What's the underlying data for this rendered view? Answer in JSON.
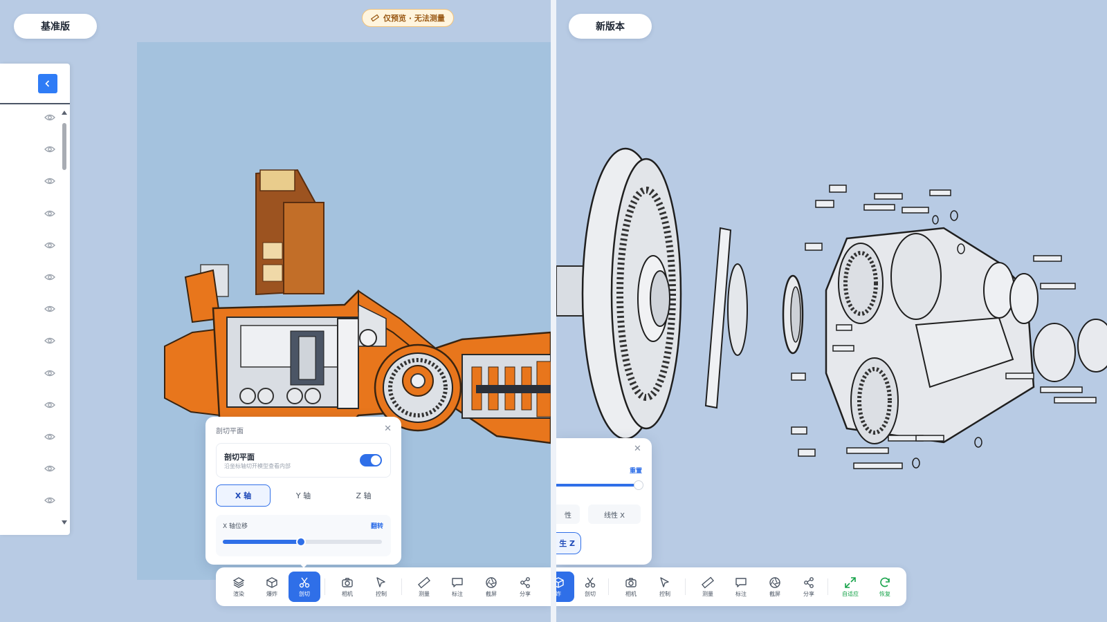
{
  "left_pane": {
    "version_label": "基准版",
    "preview_badge": "仅预览 · 无法测量",
    "eye_icon_count": 13,
    "section_popup": {
      "title": "剖切平面",
      "plane_label": "剖切平面",
      "plane_desc": "沿坐标轴切开模型查看内部",
      "enabled": true,
      "axes": [
        "X 轴",
        "Y 轴",
        "Z 轴"
      ],
      "active_axis": "X 轴",
      "offset_label": "X 轴位移",
      "flip_label": "翻转",
      "offset_value": 0.49
    },
    "toolbar": [
      {
        "label": "渲染",
        "icon": "layers-icon"
      },
      {
        "label": "爆炸",
        "icon": "cube-icon"
      },
      {
        "label": "剖切",
        "icon": "scissors-icon",
        "active": true
      },
      {
        "label": "相机",
        "icon": "camera-icon"
      },
      {
        "label": "控制",
        "icon": "pointer-icon"
      },
      {
        "label": "测量",
        "icon": "ruler-icon"
      },
      {
        "label": "标注",
        "icon": "comment-icon"
      },
      {
        "label": "截屏",
        "icon": "aperture-icon"
      },
      {
        "label": "分享",
        "icon": "share-icon"
      }
    ]
  },
  "right_pane": {
    "version_label": "新版本",
    "popup": {
      "reset_label": "重置",
      "opt_partial": "性",
      "opt_linear_x": "线性 X",
      "opt_selected_partial": "生 Z",
      "slider_value": 1.0
    },
    "toolbar": [
      {
        "label": "炸",
        "icon": "cube-icon",
        "active": true,
        "partial": true
      },
      {
        "label": "剖切",
        "icon": "scissors-icon"
      },
      {
        "label": "相机",
        "icon": "camera-icon"
      },
      {
        "label": "控制",
        "icon": "pointer-icon"
      },
      {
        "label": "测量",
        "icon": "ruler-icon"
      },
      {
        "label": "标注",
        "icon": "comment-icon"
      },
      {
        "label": "截屏",
        "icon": "aperture-icon"
      },
      {
        "label": "分享",
        "icon": "share-icon"
      },
      {
        "label": "自适应",
        "icon": "expand-icon",
        "green": true
      },
      {
        "label": "恢复",
        "icon": "refresh-icon",
        "green": true
      }
    ]
  },
  "colors": {
    "background": "#b8cbe4",
    "viewport": "#a4c2de",
    "accent": "#2f6fe8",
    "section_orange": "#e8761c",
    "model_gray": "#e4e6ea",
    "adaptive_green": "#17a34a"
  }
}
